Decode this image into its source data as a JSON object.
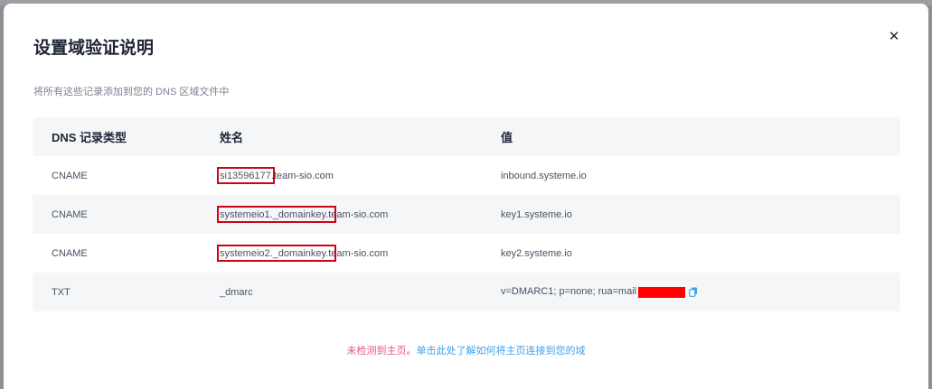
{
  "modal": {
    "title": "设置域验证说明",
    "close_icon": "close-icon",
    "subtitle": "将所有这些记录添加到您的 DNS 区域文件中"
  },
  "table": {
    "headers": [
      "DNS 记录类型",
      "姓名",
      "值"
    ],
    "rows": [
      {
        "type": "CNAME",
        "name": "si13596177.team-sio.com",
        "value": "inbound.systeme.io"
      },
      {
        "type": "CNAME",
        "name": "systemeio1._domainkey.team-sio.com",
        "value": "key1.systeme.io"
      },
      {
        "type": "CNAME",
        "name": "systemeio2._domainkey.team-sio.com",
        "value": "key2.systeme.io"
      },
      {
        "type": "TXT",
        "name": "_dmarc",
        "value": "v=DMARC1; p=none; rua=mail"
      }
    ]
  },
  "footer": {
    "status": "未检测到主页。",
    "link": "单击此处了解如何将主页连接到您的域"
  },
  "colors": {
    "accent_link": "#3fa0e8",
    "warning": "#e8527a",
    "highlight_box": "#d0021b",
    "redaction": "#ff0000"
  }
}
